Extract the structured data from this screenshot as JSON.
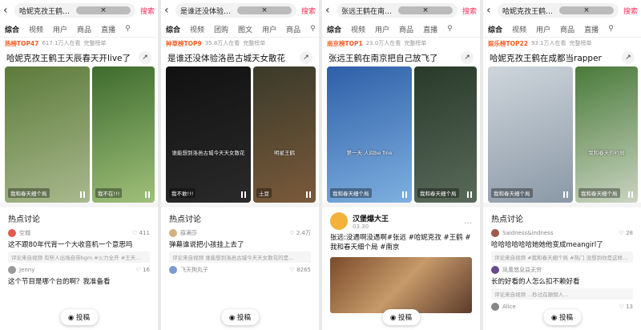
{
  "panels": [
    {
      "query": "哈妮克孜王鹤王天辰春天开live了",
      "search_label": "搜索",
      "tabs": [
        "综合",
        "视频",
        "用户",
        "商品",
        "直播"
      ],
      "rank_badge": "热榜TOP47",
      "rank_meta": "617.1万人在看",
      "rank_more": "完整榜单",
      "headline": "哈妮克孜王鹤王天辰春天开live了",
      "videos": [
        {
          "tag": "我和春天细个局",
          "caption": "",
          "colors": [
            "#5c7a3a",
            "#a9b98e"
          ]
        },
        {
          "tag": "我不在!!!",
          "caption": "",
          "colors": [
            "#3e6b2d",
            "#9fc07a"
          ]
        }
      ],
      "hot_title": "热点讨论",
      "comments": [
        {
          "user": "空城",
          "likes": "411",
          "text": "这不跟80年代背一个大收音机一个意思吗",
          "sub": "评论来自视频 有些人出场自带bgm #火力全开 #王天...",
          "avatar": "#e05a4e"
        },
        {
          "user": "Jenny",
          "likes": "16",
          "text": "这个节目是哪个台的啊？我准备看",
          "sub": "",
          "avatar": "#999999"
        }
      ],
      "post_label": "投稿"
    },
    {
      "query": "是谁还没体验洛邑古城天女散花",
      "search_label": "搜索",
      "tabs": [
        "综合",
        "视频",
        "团购",
        "图文",
        "用户",
        "商品"
      ],
      "rank_badge": "种草榜TOP9",
      "rank_meta": "35.8万人在看",
      "rank_more": "完整榜单",
      "headline": "是谁还没体验洛邑古城天女散花",
      "videos": [
        {
          "tag": "我不敢!!!",
          "caption": "谁能想到洛邑古城今天天女散花",
          "colors": [
            "#111111",
            "#2a2a2a"
          ]
        },
        {
          "tag": "土豆",
          "caption": "明星王鹤",
          "colors": [
            "#3a3a2a",
            "#7a5a3a"
          ]
        }
      ],
      "hot_title": "热点讨论",
      "comments": [
        {
          "user": "薛满莎",
          "likes": "2.4万",
          "text": "弹幕谁说把小孩挂上去了",
          "sub": "评论来自视频 谁能想到洛邑古城今天天女散花的是...",
          "avatar": "#d4b07a"
        },
        {
          "user": "飞天狗丸子",
          "likes": "8265",
          "text": "",
          "sub": "",
          "avatar": "#7a9ad4"
        }
      ],
      "post_label": "投稿"
    },
    {
      "query": "张远王鹤在南京把自己放飞了",
      "search_label": "搜索",
      "tabs": [
        "综合",
        "视频",
        "用户",
        "商品",
        "直播"
      ],
      "rank_badge": "南京榜TOP1",
      "rank_meta": "23.0万人在看",
      "rank_more": "完整榜单",
      "headline": "张远王鹤在南京把自己放飞了",
      "videos": [
        {
          "tag": "我和春天细个局",
          "caption": "第一天 人间be fine",
          "colors": [
            "#2e5fa8",
            "#7fb0e0"
          ]
        },
        {
          "tag": "我和春天细个局",
          "caption": "",
          "colors": [
            "#2a3a2a",
            "#5a6a5a"
          ]
        }
      ],
      "article": {
        "name": "汉堡爆大王",
        "date": "03.30",
        "text": "张远:没遇啊没遇啊#张远 #哈妮克孜 #王鹤 #我和春天细个局 #南京"
      },
      "post_label": "投稿"
    },
    {
      "query": "哈妮克孜王鹤在成都当rapper",
      "search_label": "搜索",
      "tabs": [
        "综合",
        "视频",
        "用户",
        "商品",
        "直播"
      ],
      "rank_badge": "娱乐榜TOP22",
      "rank_meta": "93.1万人在看",
      "rank_more": "完整榜单",
      "headline": "哈妮克孜王鹤在成都当rapper",
      "videos": [
        {
          "tag": "我和春天细个局",
          "caption": "",
          "colors": [
            "#cfd6dc",
            "#8a98a6"
          ]
        },
        {
          "tag": "我和春天细个局",
          "caption": "我和春天的约局",
          "colors": [
            "#4a7a3a",
            "#c9d4c0"
          ]
        }
      ],
      "hot_title": "热点讨论",
      "comments": [
        {
          "user": "Saidness&indness",
          "likes": "28",
          "text": "哈哈哈哈哈哈她她他变成meangirl了",
          "sub": "评论来自视频 #我和春天细个局 #热门 没想到你是这样的...",
          "avatar": "#a05a4a"
        },
        {
          "user": "凤凰悠息益无穷",
          "likes": "",
          "text": "长的好看的人怎么扣不赖好看",
          "sub": "评论来自视频 ...秒过在颠倒人...",
          "avatar": "#6a4a8a"
        },
        {
          "user": "Alice",
          "likes": "13",
          "text": "",
          "sub": "",
          "avatar": "#888888"
        }
      ],
      "post_label": "投稿"
    }
  ]
}
